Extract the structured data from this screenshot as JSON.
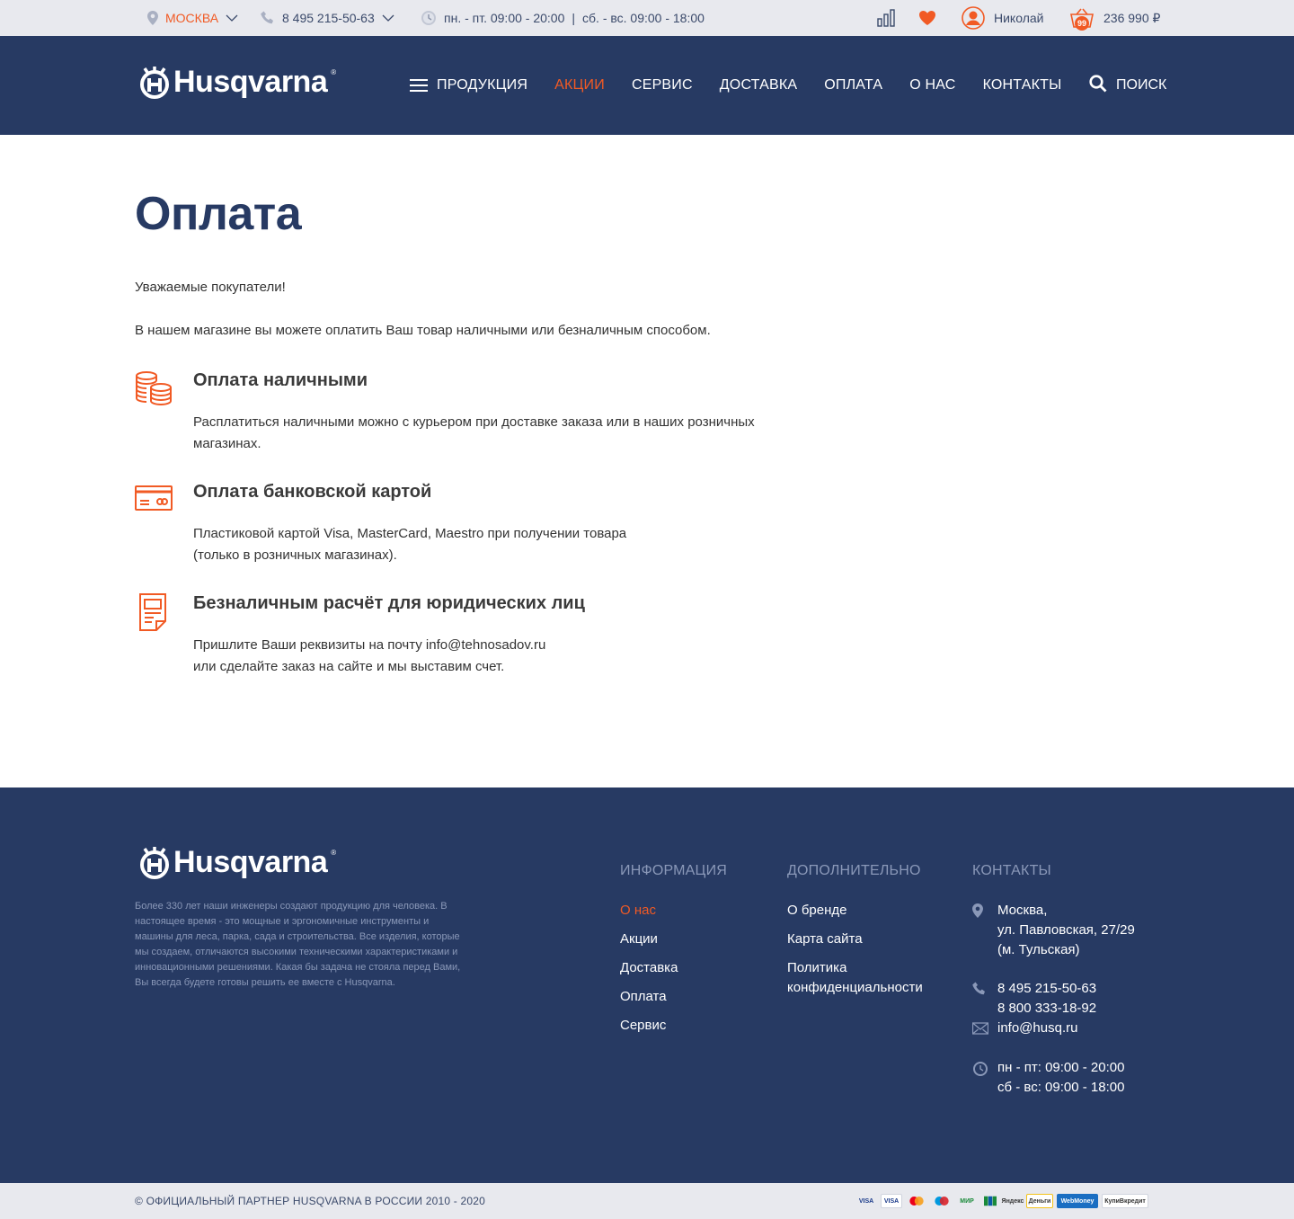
{
  "topbar": {
    "city": "МОСКВА",
    "phone": "8 495 215-50-63",
    "hours_weekdays": "пн. - пт. 09:00 - 20:00",
    "hours_separator": "|",
    "hours_weekend": "сб. - вс. 09:00 - 18:00",
    "user_name": "Николай",
    "cart_count": "99",
    "cart_total": "236 990 ₽"
  },
  "header": {
    "logo_text": "Husqvarna",
    "nav": [
      {
        "label": "ПРОДУКЦИЯ"
      },
      {
        "label": "АКЦИИ"
      },
      {
        "label": "СЕРВИС"
      },
      {
        "label": "ДОСТАВКА"
      },
      {
        "label": "ОПЛАТА"
      },
      {
        "label": "О НАС"
      },
      {
        "label": "КОНТАКТЫ"
      }
    ],
    "search_label": "ПОИСК"
  },
  "main": {
    "title": "Оплата",
    "greeting": "Уважаемые покупатели!",
    "lead": "В нашем магазине вы можете оплатить Ваш товар наличными или безналичным способом.",
    "methods": [
      {
        "icon": "coins-icon",
        "title": "Оплата наличными",
        "line1": "Расплатиться наличными можно с курьером при доставке заказа или в наших розничных",
        "line2": "магазинах."
      },
      {
        "icon": "credit-card-icon",
        "title": "Оплата банковской картой",
        "line1": "Пластиковой картой Visa, MasterCard, Maestro при получении товара",
        "line2": "(только в розничных магазинах)."
      },
      {
        "icon": "document-icon",
        "title": "Безналичным расчёт для юридических лиц",
        "line1": "Пришлите Ваши реквизиты на почту  info@tehnosadov.ru",
        "line2": "или сделайте заказ на сайте и мы выставим счет."
      }
    ]
  },
  "footer": {
    "logo_text": "Husqvarna",
    "about": "Более 330 лет наши инженеры создают продукцию для человека. В настоящее время - это мощные и эргономичные инструменты и машины для леса, парка, сада и строительства. Все изделия, которые мы создаем, отличаются высокими техническими характеристиками и инновационными решениями. Какая бы задача не стояла перед Вами, Вы всегда будете готовы решить ее вместе с Husqvarna.",
    "info": {
      "heading": "ИНФОРМАЦИЯ",
      "links": [
        "О нас",
        "Акции",
        "Доставка",
        "Оплата",
        "Сервис"
      ]
    },
    "extra": {
      "heading": "ДОПОЛНИТЕЛЬНО",
      "links": [
        "О бренде",
        "Карта сайта",
        "Политика конфиденциальности"
      ]
    },
    "contacts": {
      "heading": "КОНТАКТЫ",
      "address_line1": "Москва,",
      "address_line2": "ул. Павловская, 27/29",
      "address_line3": "(м. Тульская)",
      "phone1": "8 495 215-50-63",
      "phone2": "8 800 333-18-92",
      "email": "info@husq.ru",
      "hours1": "пн - пт: 09:00 - 20:00",
      "hours2": "сб - вс: 09:00 - 18:00"
    }
  },
  "bottombar": {
    "copyright": "© ОФИЦИАЛЬНЫЙ ПАРТНЕР HUSQVARNA В РОССИИ 2010 - 2020",
    "payment_logos": [
      "VISA",
      "VISA",
      "",
      "",
      "МИР",
      "",
      "Яндекс",
      "Деньги",
      "WebMoney",
      "КупиВкредит"
    ]
  },
  "colors": {
    "accent": "#f15a24",
    "navy": "#273a63",
    "bar_gray": "#e8e9ee"
  }
}
